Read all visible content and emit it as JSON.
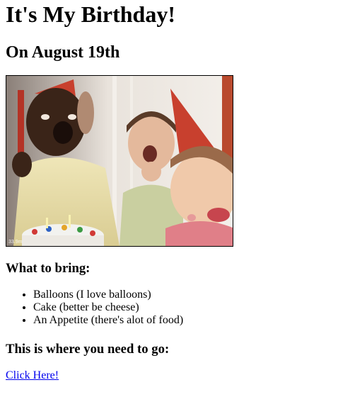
{
  "header": {
    "title": "It's My Birthday!",
    "subtitle": "On August 19th"
  },
  "photo": {
    "watermark": "33.9m"
  },
  "bring": {
    "heading": "What to bring:",
    "items": [
      "Balloons (I love balloons)",
      "Cake (better be cheese)",
      "An Appetite (there's alot of food)"
    ]
  },
  "directions": {
    "heading": "This is where you need to go:",
    "link_label": "Click Here!"
  },
  "colors": {
    "link": "#0000ee",
    "party_hat_red": "#c8402e"
  }
}
